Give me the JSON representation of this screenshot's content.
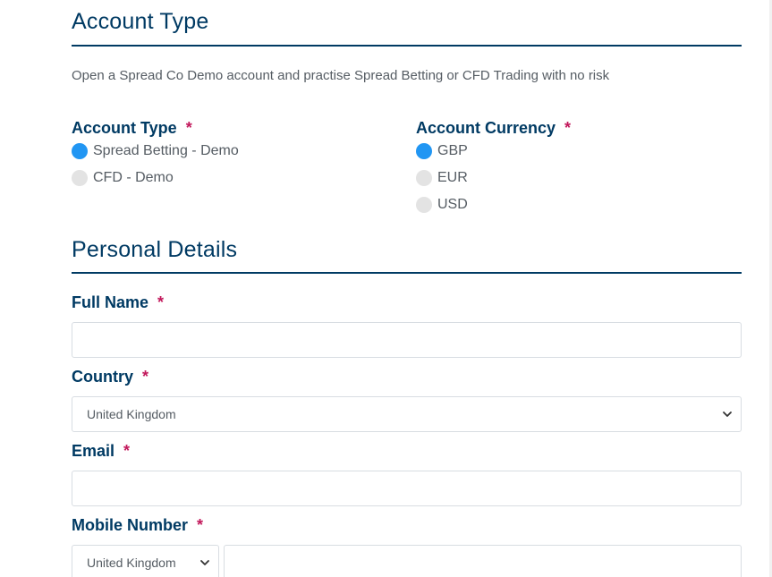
{
  "account_section": {
    "title": "Account Type",
    "intro": "Open a Spread Co Demo account and practise Spread Betting or CFD Trading with no risk",
    "account_type": {
      "label": "Account Type",
      "required_mark": "*",
      "options": [
        {
          "label": "Spread Betting - Demo",
          "selected": true
        },
        {
          "label": "CFD - Demo",
          "selected": false
        }
      ]
    },
    "account_currency": {
      "label": "Account Currency",
      "required_mark": "*",
      "options": [
        {
          "label": "GBP",
          "selected": true
        },
        {
          "label": "EUR",
          "selected": false
        },
        {
          "label": "USD",
          "selected": false
        }
      ]
    }
  },
  "personal_section": {
    "title": "Personal Details",
    "full_name": {
      "label": "Full Name",
      "required_mark": "*",
      "value": ""
    },
    "country": {
      "label": "Country",
      "required_mark": "*",
      "selected": "United Kingdom"
    },
    "email": {
      "label": "Email",
      "required_mark": "*",
      "value": ""
    },
    "mobile": {
      "label": "Mobile Number",
      "required_mark": "*",
      "country_selected": "United Kingdom",
      "value": ""
    }
  },
  "colors": {
    "heading": "#003a63",
    "required": "#c2185b",
    "radio_selected": "#2196f3",
    "radio_unselected": "#e3e3e3",
    "body_text": "#555c63"
  },
  "icons": {
    "select_chevron": "chevron-down-icon"
  }
}
